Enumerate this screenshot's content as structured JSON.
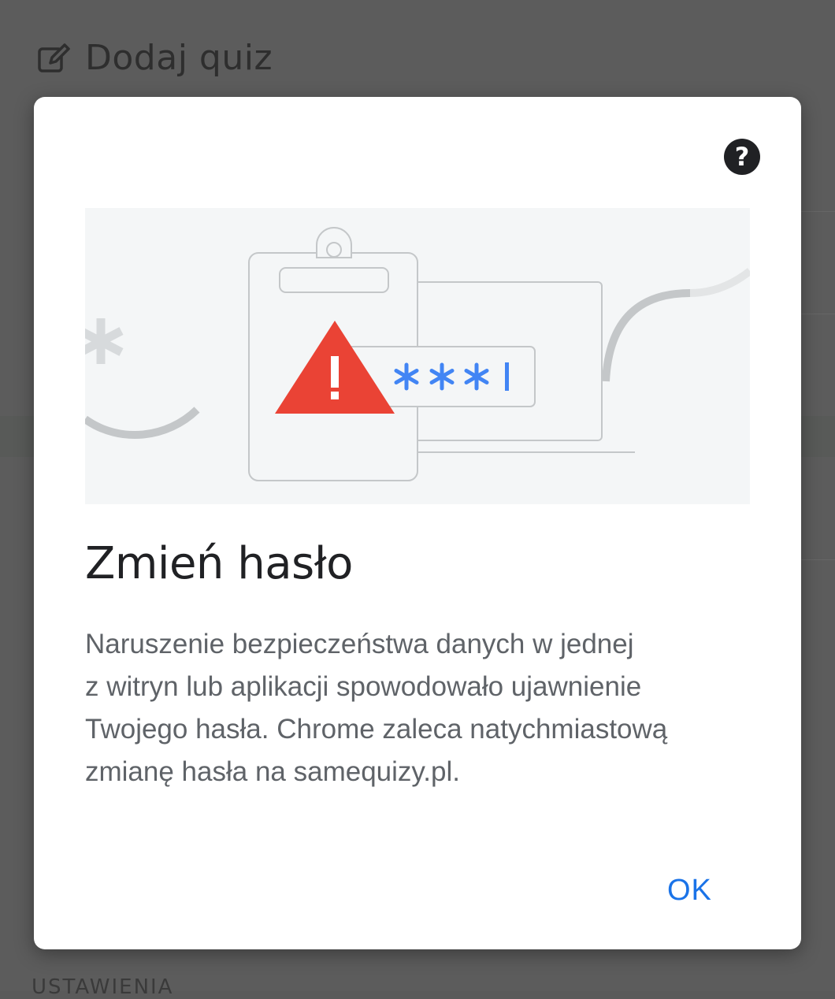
{
  "background": {
    "header_icon": "edit-icon",
    "header_title": "Dodaj quiz",
    "footer_text": "USTAWIENIA"
  },
  "dialog": {
    "help_icon": "help-icon",
    "help_glyph": "?",
    "illustration": {
      "alert_icon": "warning-triangle-icon",
      "alert_glyph": "!",
      "masked_password": "***",
      "colors": {
        "warning": "#ea4335",
        "password": "#4285f4",
        "stroke": "#c4c7c9",
        "background": "#f4f6f7"
      }
    },
    "title": "Zmień hasło",
    "body_lines": [
      "Naruszenie bezpieczeństwa danych w jednej",
      "z witryn lub aplikacji spowodowało ujawnienie",
      "Twojego hasła. Chrome zaleca natychmiastową",
      "zmianę hasła na samequizy.pl."
    ],
    "ok_label": "OK",
    "accent_color": "#1a73e8"
  }
}
